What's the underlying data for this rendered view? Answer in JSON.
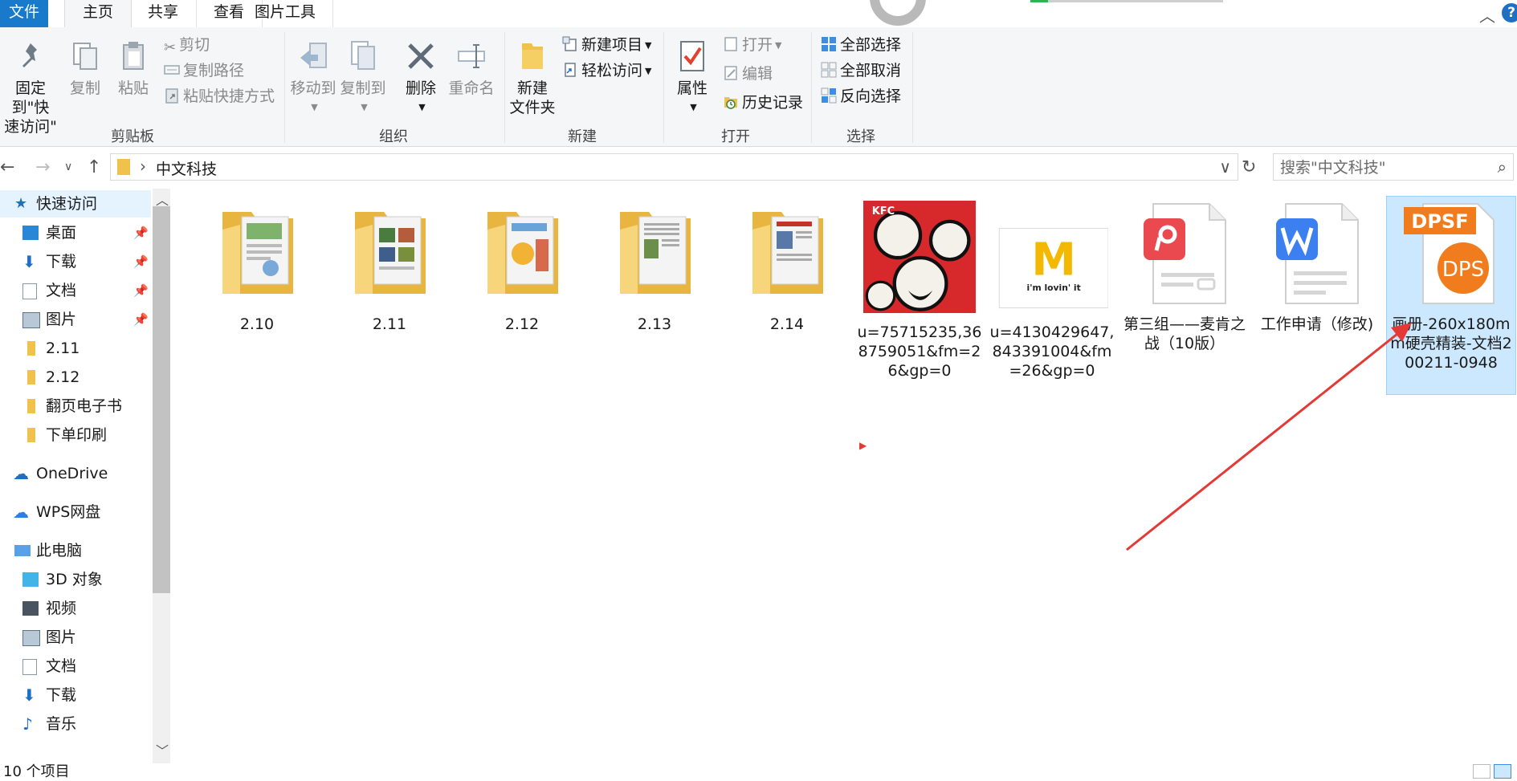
{
  "tabs": {
    "file": "文件",
    "home": "主页",
    "share": "共享",
    "view": "查看",
    "picture_tools": "图片工具"
  },
  "ribbon": {
    "clipboard": {
      "pin_line1": "固定到\"快",
      "pin_line2": "速访问\"",
      "copy": "复制",
      "paste": "粘贴",
      "cut": "剪切",
      "copy_path": "复制路径",
      "paste_shortcut": "粘贴快捷方式",
      "group_label": "剪贴板"
    },
    "organize": {
      "move_to": "移动到",
      "copy_to": "复制到",
      "delete": "删除",
      "rename": "重命名",
      "group_label": "组织"
    },
    "new": {
      "new_folder_line1": "新建",
      "new_folder_line2": "文件夹",
      "new_item": "新建项目",
      "easy_access": "轻松访问",
      "group_label": "新建"
    },
    "open": {
      "properties": "属性",
      "open": "打开",
      "edit": "编辑",
      "history": "历史记录",
      "group_label": "打开"
    },
    "select": {
      "select_all": "全部选择",
      "select_none": "全部取消",
      "invert": "反向选择",
      "group_label": "选择"
    }
  },
  "address": {
    "crumb": "中文科技",
    "search_placeholder": "搜索\"中文科技\""
  },
  "sidebar": {
    "items": [
      {
        "label": "快速访问",
        "icon": "star-icon"
      },
      {
        "label": "桌面",
        "icon": "desktop-icon"
      },
      {
        "label": "下载",
        "icon": "download-icon"
      },
      {
        "label": "文档",
        "icon": "document-icon"
      },
      {
        "label": "图片",
        "icon": "picture-icon"
      },
      {
        "label": "2.11",
        "icon": "folder-icon"
      },
      {
        "label": "2.12",
        "icon": "folder-icon"
      },
      {
        "label": "翻页电子书",
        "icon": "folder-icon"
      },
      {
        "label": "下单印刷",
        "icon": "folder-icon"
      },
      {
        "label": "OneDrive",
        "icon": "cloud-icon"
      },
      {
        "label": "WPS网盘",
        "icon": "cloud-outline-icon"
      },
      {
        "label": "此电脑",
        "icon": "computer-icon"
      },
      {
        "label": "3D 对象",
        "icon": "cube-icon"
      },
      {
        "label": "视频",
        "icon": "film-icon"
      },
      {
        "label": "图片",
        "icon": "picture-icon"
      },
      {
        "label": "文档",
        "icon": "document-icon"
      },
      {
        "label": "下载",
        "icon": "download-icon"
      },
      {
        "label": "音乐",
        "icon": "music-icon"
      }
    ]
  },
  "files": [
    {
      "name": "2.10",
      "type": "folder"
    },
    {
      "name": "2.11",
      "type": "folder"
    },
    {
      "name": "2.12",
      "type": "folder"
    },
    {
      "name": "2.13",
      "type": "folder"
    },
    {
      "name": "2.14",
      "type": "folder"
    },
    {
      "name": "u=75715235,368759051&fm=26&gp=0",
      "type": "image-kfc"
    },
    {
      "name": "u=4130429647,843391004&fm=26&gp=0",
      "type": "image-mcd"
    },
    {
      "name": "第三组——麦肯之战（10版）",
      "type": "wps-pdf"
    },
    {
      "name": "工作申请（修改)",
      "type": "wps-word"
    },
    {
      "name": "画册-260x180mm硬壳精装-文档200211-0948",
      "type": "dpsf"
    }
  ],
  "thumb_text": {
    "kfc": "KFC",
    "mcd_m": "M",
    "mcd_slogan": "i'm lovin' it",
    "dpsf_badge": "DPSF",
    "dps": "DPS"
  },
  "status": {
    "count": "10 个项目"
  },
  "colors": {
    "accent": "#1979ca",
    "folder": "#f0c24b",
    "selection": "#cce8ff",
    "annotation_arrow": "#e53935"
  }
}
